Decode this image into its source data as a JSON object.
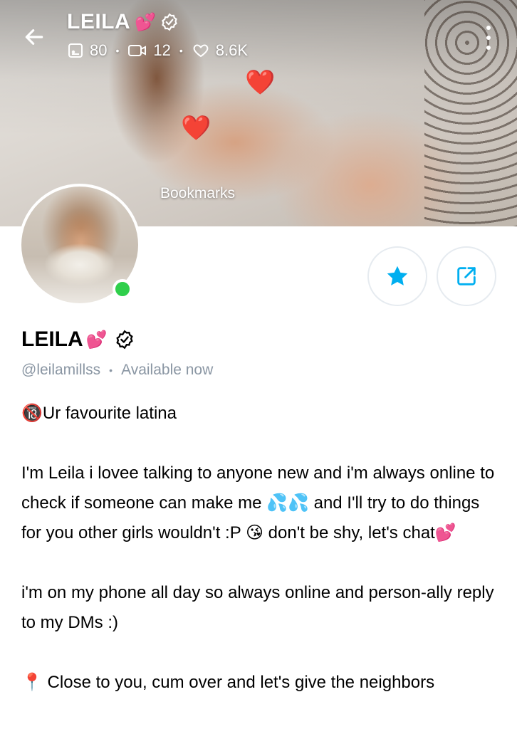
{
  "header": {
    "name": "LEILA",
    "name_emoji": "💕",
    "stats": {
      "photos": "80",
      "videos": "12",
      "likes": "8.6K"
    },
    "cover_label": "Bookmarks"
  },
  "profile": {
    "name": "LEILA",
    "name_emoji": "💕",
    "handle": "@leilamillss",
    "status": "Available now",
    "online": true
  },
  "icons": {
    "back": "arrow-left-icon",
    "verified": "verified-badge-icon",
    "photos": "image-icon",
    "videos": "video-icon",
    "likes": "heart-icon",
    "more": "more-vertical-icon",
    "favorite": "star-icon",
    "share": "share-icon"
  },
  "colors": {
    "accent": "#00aff0",
    "online": "#2fcf4b",
    "muted_text": "#8a96a3"
  },
  "bio": {
    "line1": "🔞Ur favourite latina",
    "para2": "I'm Leila i lovee talking to anyone new and i'm always online to check if someone can make me 💦💦 and I'll try to do things for you other girls wouldn't :P 😘 don't be shy, let's chat💕",
    "para3": "i'm on my phone all day so always online and person-ally reply to my DMs :)",
    "para4": "📍 Close to you, cum over and let's give the neighbors"
  }
}
